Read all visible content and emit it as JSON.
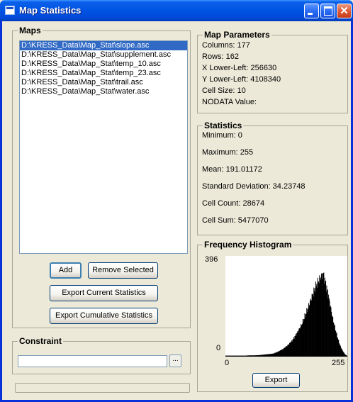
{
  "window": {
    "title": "Map Statistics"
  },
  "maps": {
    "title": "Maps",
    "items": [
      "D:\\KRESS_Data\\Map_Stat\\slope.asc",
      "D:\\KRESS_Data\\Map_Stat\\supplement.asc",
      "D:\\KRESS_Data\\Map_Stat\\temp_10.asc",
      "D:\\KRESS_Data\\Map_Stat\\temp_23.asc",
      "D:\\KRESS_Data\\Map_Stat\\trail.asc",
      "D:\\KRESS_Data\\Map_Stat\\water.asc"
    ],
    "selected_index": 0,
    "add_label": "Add",
    "remove_label": "Remove Selected",
    "export_current_label": "Export Current Statistics",
    "export_cumulative_label": "Export Cumulative Statistics"
  },
  "constraint": {
    "title": "Constraint",
    "value": "",
    "browse_label": "..."
  },
  "map_parameters": {
    "title": "Map Parameters",
    "columns": "Columns: 177",
    "rows": "Rows: 162",
    "x_lower_left": "X Lower-Left: 256630",
    "y_lower_left": "Y Lower-Left: 4108340",
    "cell_size": "Cell Size: 10",
    "nodata": "NODATA Value:"
  },
  "statistics": {
    "title": "Statistics",
    "minimum": "Minimum: 0",
    "maximum": "Maximum: 255",
    "mean": "Mean: 191.01172",
    "std_dev": "Standard Deviation: 34.23748",
    "cell_count": "Cell Count: 28674",
    "cell_sum": "Cell Sum: 5477070"
  },
  "histogram": {
    "title": "Frequency Histogram",
    "export_label": "Export",
    "y_max_label": "396",
    "y_min_label": "0",
    "x_min_label": "0",
    "x_max_label": "255",
    "bar_color": "#000000"
  },
  "chart_data": {
    "type": "bar",
    "title": "Frequency Histogram",
    "xlim": [
      0,
      255
    ],
    "ylim": [
      0,
      396
    ],
    "x": [
      0,
      10,
      20,
      30,
      40,
      50,
      60,
      70,
      80,
      90,
      100,
      110,
      120,
      130,
      140,
      150,
      160,
      170,
      180,
      190,
      200,
      205,
      210,
      215,
      220,
      225,
      230,
      235,
      240,
      245,
      250,
      255
    ],
    "values": [
      4,
      4,
      4,
      4,
      4,
      5,
      5,
      6,
      8,
      10,
      12,
      20,
      30,
      45,
      65,
      95,
      130,
      180,
      235,
      285,
      320,
      330,
      290,
      250,
      200,
      150,
      110,
      75,
      45,
      25,
      10,
      3
    ]
  }
}
